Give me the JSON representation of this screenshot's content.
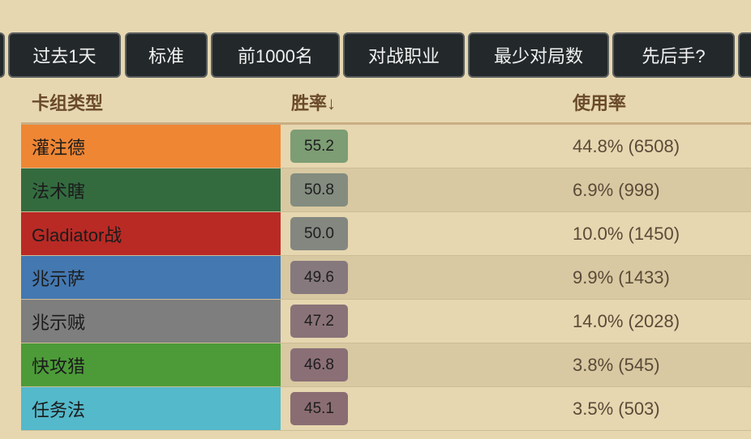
{
  "filters": [
    {
      "label": ""
    },
    {
      "label": "过去1天"
    },
    {
      "label": "标准"
    },
    {
      "label": "前1000名"
    },
    {
      "label": "对战职业"
    },
    {
      "label": "最少对局数"
    },
    {
      "label": "先后手?"
    },
    {
      "label": ""
    }
  ],
  "table": {
    "headers": {
      "deck_type": "卡组类型",
      "win_rate": "胜率↓",
      "usage": "使用率"
    },
    "rows": [
      {
        "deck": "灌注德",
        "win_rate": "55.2",
        "usage": "44.8% (6508)",
        "deck_color": "#ef8634",
        "wr_color": "#7d9d74"
      },
      {
        "deck": "法术瞎",
        "win_rate": "50.8",
        "usage": "6.9% (998)",
        "deck_color": "#336b3f",
        "wr_color": "#838c7f"
      },
      {
        "deck": "Gladiator战",
        "win_rate": "50.0",
        "usage": "10.0% (1450)",
        "deck_color": "#b92a25",
        "wr_color": "#838780"
      },
      {
        "deck": "兆示萨",
        "win_rate": "49.6",
        "usage": "9.9% (1433)",
        "deck_color": "#4478b0",
        "wr_color": "#86797d"
      },
      {
        "deck": "兆示贼",
        "win_rate": "47.2",
        "usage": "14.0% (2028)",
        "deck_color": "#7e7e7e",
        "wr_color": "#8a7378"
      },
      {
        "deck": "快攻猎",
        "win_rate": "46.8",
        "usage": "3.8% (545)",
        "deck_color": "#4c9b38",
        "wr_color": "#8a6f76"
      },
      {
        "deck": "任务法",
        "win_rate": "45.1",
        "usage": "3.5% (503)",
        "deck_color": "#54b9cb",
        "wr_color": "#8a6d72"
      }
    ]
  }
}
